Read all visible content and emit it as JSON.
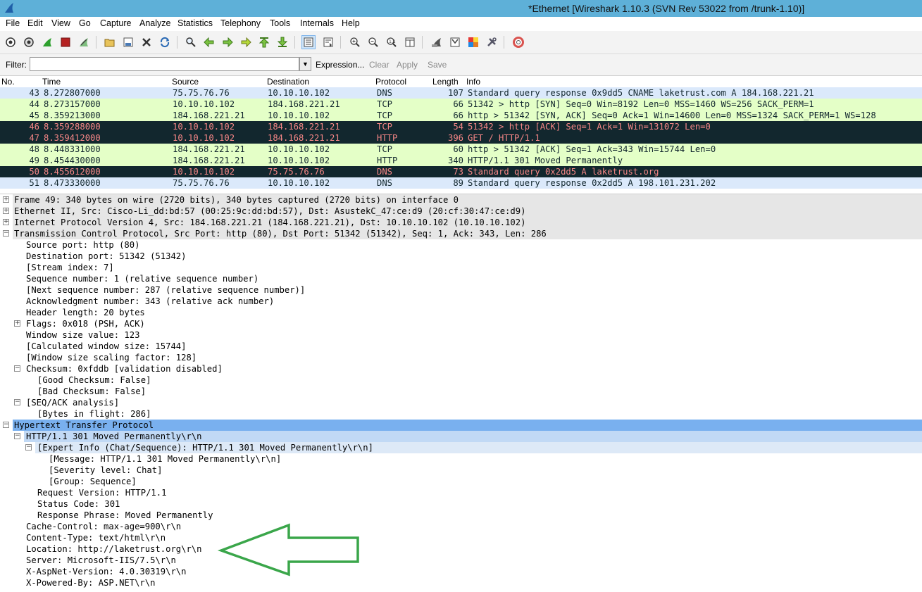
{
  "window": {
    "title": "*Ethernet    [Wireshark 1.10.3  (SVN Rev 53022 from /trunk-1.10)]",
    "logo_icon": "wireshark-fin-icon"
  },
  "menu": [
    "File",
    "Edit",
    "View",
    "Go",
    "Capture",
    "Analyze",
    "Statistics",
    "Telephony",
    "Tools",
    "Internals",
    "Help"
  ],
  "toolbar": {
    "icons": [
      "interfaces-icon",
      "options-icon",
      "start-capture-icon",
      "stop-capture-icon",
      "restart-capture-icon",
      "open-file-icon",
      "save-file-icon",
      "close-file-icon",
      "reload-icon",
      "find-packet-icon",
      "go-back-icon",
      "go-forward-icon",
      "go-to-packet-icon",
      "go-first-icon",
      "go-last-icon",
      "colorize-icon",
      "autoscroll-icon",
      "zoom-in-icon",
      "zoom-out-icon",
      "normal-size-icon",
      "resize-columns-icon",
      "capture-filters-icon",
      "display-filters-icon",
      "coloring-rules-icon",
      "preferences-icon",
      "help-icon"
    ]
  },
  "filter": {
    "label": "Filter:",
    "value": "",
    "expression": "Expression...",
    "clear": "Clear",
    "apply": "Apply",
    "save": "Save"
  },
  "packet_list": {
    "columns": [
      "No.",
      "Time",
      "Source",
      "Destination",
      "Protocol",
      "Length",
      "Info"
    ],
    "rows": [
      {
        "no": "43",
        "time": "8.272807000",
        "src": "75.75.76.76",
        "dst": "10.10.10.102",
        "proto": "DNS",
        "len": "107",
        "info": "Standard query response 0x9dd5  CNAME laketrust.com A 184.168.221.21",
        "bg": "#dbe9fb",
        "fg": "#12272e"
      },
      {
        "no": "44",
        "time": "8.273157000",
        "src": "10.10.10.102",
        "dst": "184.168.221.21",
        "proto": "TCP",
        "len": "66",
        "info": "51342 > http [SYN] Seq=0 Win=8192 Len=0 MSS=1460 WS=256 SACK_PERM=1",
        "bg": "#e4ffc7",
        "fg": "#12272e"
      },
      {
        "no": "45",
        "time": "8.359213000",
        "src": "184.168.221.21",
        "dst": "10.10.10.102",
        "proto": "TCP",
        "len": "66",
        "info": "http > 51342 [SYN, ACK] Seq=0 Ack=1 Win=14600 Len=0 MSS=1324 SACK_PERM=1 WS=128",
        "bg": "#e4ffc7",
        "fg": "#12272e"
      },
      {
        "no": "46",
        "time": "8.359288000",
        "src": "10.10.10.102",
        "dst": "184.168.221.21",
        "proto": "TCP",
        "len": "54",
        "info": "51342 > http [ACK] Seq=1 Ack=1 Win=131072 Len=0",
        "bg": "#12272e",
        "fg": "#f78787"
      },
      {
        "no": "47",
        "time": "8.359412000",
        "src": "10.10.10.102",
        "dst": "184.168.221.21",
        "proto": "HTTP",
        "len": "396",
        "info": "GET / HTTP/1.1",
        "bg": "#12272e",
        "fg": "#f78787"
      },
      {
        "no": "48",
        "time": "8.448331000",
        "src": "184.168.221.21",
        "dst": "10.10.10.102",
        "proto": "TCP",
        "len": "60",
        "info": "http > 51342 [ACK] Seq=1 Ack=343 Win=15744 Len=0",
        "bg": "#e4ffc7",
        "fg": "#12272e"
      },
      {
        "no": "49",
        "time": "8.454430000",
        "src": "184.168.221.21",
        "dst": "10.10.10.102",
        "proto": "HTTP",
        "len": "340",
        "info": "HTTP/1.1 301 Moved Permanently",
        "bg": "#e4ffc7",
        "fg": "#12272e"
      },
      {
        "no": "50",
        "time": "8.455612000",
        "src": "10.10.10.102",
        "dst": "75.75.76.76",
        "proto": "DNS",
        "len": "73",
        "info": "Standard query 0x2dd5  A laketrust.org",
        "bg": "#12272e",
        "fg": "#f78787"
      },
      {
        "no": "51",
        "time": "8.473330000",
        "src": "75.75.76.76",
        "dst": "10.10.10.102",
        "proto": "DNS",
        "len": "89",
        "info": "Standard query response 0x2dd5  A 198.101.231.202",
        "bg": "#dbe9fb",
        "fg": "#12272e"
      }
    ]
  },
  "details": [
    {
      "level": 0,
      "exp": "+",
      "style": "hdr",
      "text": "Frame 49: 340 bytes on wire (2720 bits), 340 bytes captured (2720 bits) on interface 0"
    },
    {
      "level": 0,
      "exp": "+",
      "style": "hdr",
      "text": "Ethernet II, Src: Cisco-Li_dd:bd:57 (00:25:9c:dd:bd:57), Dst: AsustekC_47:ce:d9 (20:cf:30:47:ce:d9)"
    },
    {
      "level": 0,
      "exp": "+",
      "style": "hdr",
      "text": "Internet Protocol Version 4, Src: 184.168.221.21 (184.168.221.21), Dst: 10.10.10.102 (10.10.10.102)"
    },
    {
      "level": 0,
      "exp": "-",
      "style": "hdr",
      "text": "Transmission Control Protocol, Src Port: http (80), Dst Port: 51342 (51342), Seq: 1, Ack: 343, Len: 286"
    },
    {
      "level": 1,
      "exp": "",
      "style": "",
      "text": "Source port: http (80)"
    },
    {
      "level": 1,
      "exp": "",
      "style": "",
      "text": "Destination port: 51342 (51342)"
    },
    {
      "level": 1,
      "exp": "",
      "style": "",
      "text": "[Stream index: 7]"
    },
    {
      "level": 1,
      "exp": "",
      "style": "",
      "text": "Sequence number: 1    (relative sequence number)"
    },
    {
      "level": 1,
      "exp": "",
      "style": "",
      "text": "[Next sequence number: 287    (relative sequence number)]"
    },
    {
      "level": 1,
      "exp": "",
      "style": "",
      "text": "Acknowledgment number: 343    (relative ack number)"
    },
    {
      "level": 1,
      "exp": "",
      "style": "",
      "text": "Header length: 20 bytes"
    },
    {
      "level": 1,
      "exp": "+",
      "style": "",
      "text": "Flags: 0x018 (PSH, ACK)"
    },
    {
      "level": 1,
      "exp": "",
      "style": "",
      "text": "Window size value: 123"
    },
    {
      "level": 1,
      "exp": "",
      "style": "",
      "text": "[Calculated window size: 15744]"
    },
    {
      "level": 1,
      "exp": "",
      "style": "",
      "text": "[Window size scaling factor: 128]"
    },
    {
      "level": 1,
      "exp": "-",
      "style": "",
      "text": "Checksum: 0xfddb [validation disabled]"
    },
    {
      "level": 2,
      "exp": "",
      "style": "",
      "text": "[Good Checksum: False]"
    },
    {
      "level": 2,
      "exp": "",
      "style": "",
      "text": "[Bad Checksum: False]"
    },
    {
      "level": 1,
      "exp": "-",
      "style": "",
      "text": "[SEQ/ACK analysis]"
    },
    {
      "level": 2,
      "exp": "",
      "style": "",
      "text": "[Bytes in flight: 286]"
    },
    {
      "level": 0,
      "exp": "-",
      "style": "sel1",
      "text": "Hypertext Transfer Protocol"
    },
    {
      "level": 1,
      "exp": "-",
      "style": "sel2",
      "text": "HTTP/1.1 301 Moved Permanently\\r\\n"
    },
    {
      "level": 2,
      "exp": "-",
      "style": "sel3",
      "text": "[Expert Info (Chat/Sequence): HTTP/1.1 301 Moved Permanently\\r\\n]"
    },
    {
      "level": 3,
      "exp": "",
      "style": "",
      "text": "[Message: HTTP/1.1 301 Moved Permanently\\r\\n]"
    },
    {
      "level": 3,
      "exp": "",
      "style": "",
      "text": "[Severity level: Chat]"
    },
    {
      "level": 3,
      "exp": "",
      "style": "",
      "text": "[Group: Sequence]"
    },
    {
      "level": 2,
      "exp": "",
      "style": "",
      "text": "Request Version: HTTP/1.1"
    },
    {
      "level": 2,
      "exp": "",
      "style": "",
      "text": "Status Code: 301"
    },
    {
      "level": 2,
      "exp": "",
      "style": "",
      "text": "Response Phrase: Moved Permanently"
    },
    {
      "level": 1,
      "exp": "",
      "style": "",
      "text": "Cache-Control: max-age=900\\r\\n"
    },
    {
      "level": 1,
      "exp": "",
      "style": "",
      "text": "Content-Type: text/html\\r\\n"
    },
    {
      "level": 1,
      "exp": "",
      "style": "",
      "text": "Location: http://laketrust.org\\r\\n"
    },
    {
      "level": 1,
      "exp": "",
      "style": "",
      "text": "Server: Microsoft-IIS/7.5\\r\\n"
    },
    {
      "level": 1,
      "exp": "",
      "style": "",
      "text": "X-AspNet-Version: 4.0.30319\\r\\n"
    },
    {
      "level": 1,
      "exp": "",
      "style": "",
      "text": "X-Powered-By: ASP.NET\\r\\n"
    }
  ],
  "annotation": {
    "arrow_color": "#3aa64a",
    "icon": "left-arrow-annotation-icon"
  }
}
